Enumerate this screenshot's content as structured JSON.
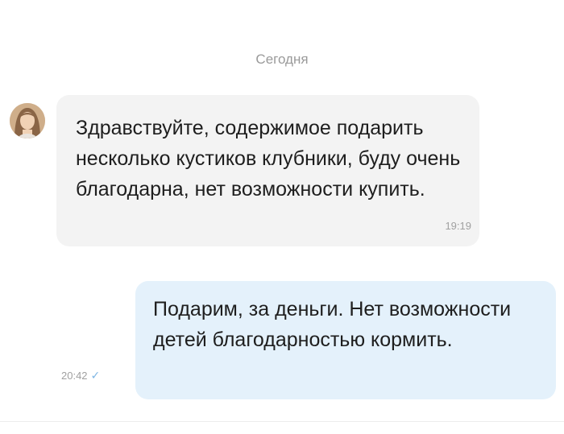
{
  "chat": {
    "date_separator": "Сегодня",
    "messages": [
      {
        "direction": "incoming",
        "text": "Здравствуйте, содержимое подарить несколько кустиков клубники, буду очень благодарна, нет возможности купить.",
        "time": "19:19"
      },
      {
        "direction": "outgoing",
        "text": "Подарим, за деньги. Нет возможности детей благодарностью кормить.",
        "time": "20:42"
      }
    ],
    "read_icon": "checkmark-icon"
  },
  "colors": {
    "incoming_bubble": "#f3f3f3",
    "outgoing_bubble": "#e4f1fb",
    "meta_text": "#a0a0a0",
    "check": "#7fb6e3"
  }
}
